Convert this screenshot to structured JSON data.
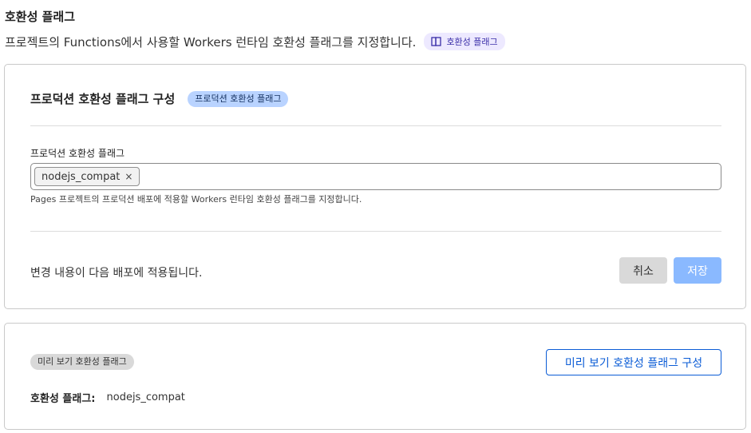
{
  "header": {
    "title": "호환성 플래그",
    "description": "프로젝트의 Functions에서 사용할 Workers 런타임 호환성 플래그를 지정합니다.",
    "docs_badge": "호환성 플래그"
  },
  "production": {
    "title": "프로덕션 호환성 플래그 구성",
    "badge": "프로덕션 호환성 플래그",
    "field_label": "프로덕션 호환성 플래그",
    "tags": [
      {
        "label": "nodejs_compat",
        "remove": "×"
      }
    ],
    "help_text": "Pages 프로젝트의 프로덕션 배포에 적용할 Workers 런타임 호환성 플래그를 지정합니다.",
    "footer_note": "변경 내용이 다음 배포에 적용됩니다.",
    "cancel_label": "취소",
    "save_label": "저장"
  },
  "preview": {
    "badge": "미리 보기 호환성 플래그",
    "configure_label": "미리 보기 호환성 플래그 구성",
    "flags_label": "호환성 플래그:",
    "flags_value": "nodejs_compat"
  },
  "colors": {
    "accent": "#0b5cd6",
    "save_disabled": "#8ab9ff",
    "badge_blue": "#b9d3ff",
    "badge_purple": "#ede9ff"
  }
}
